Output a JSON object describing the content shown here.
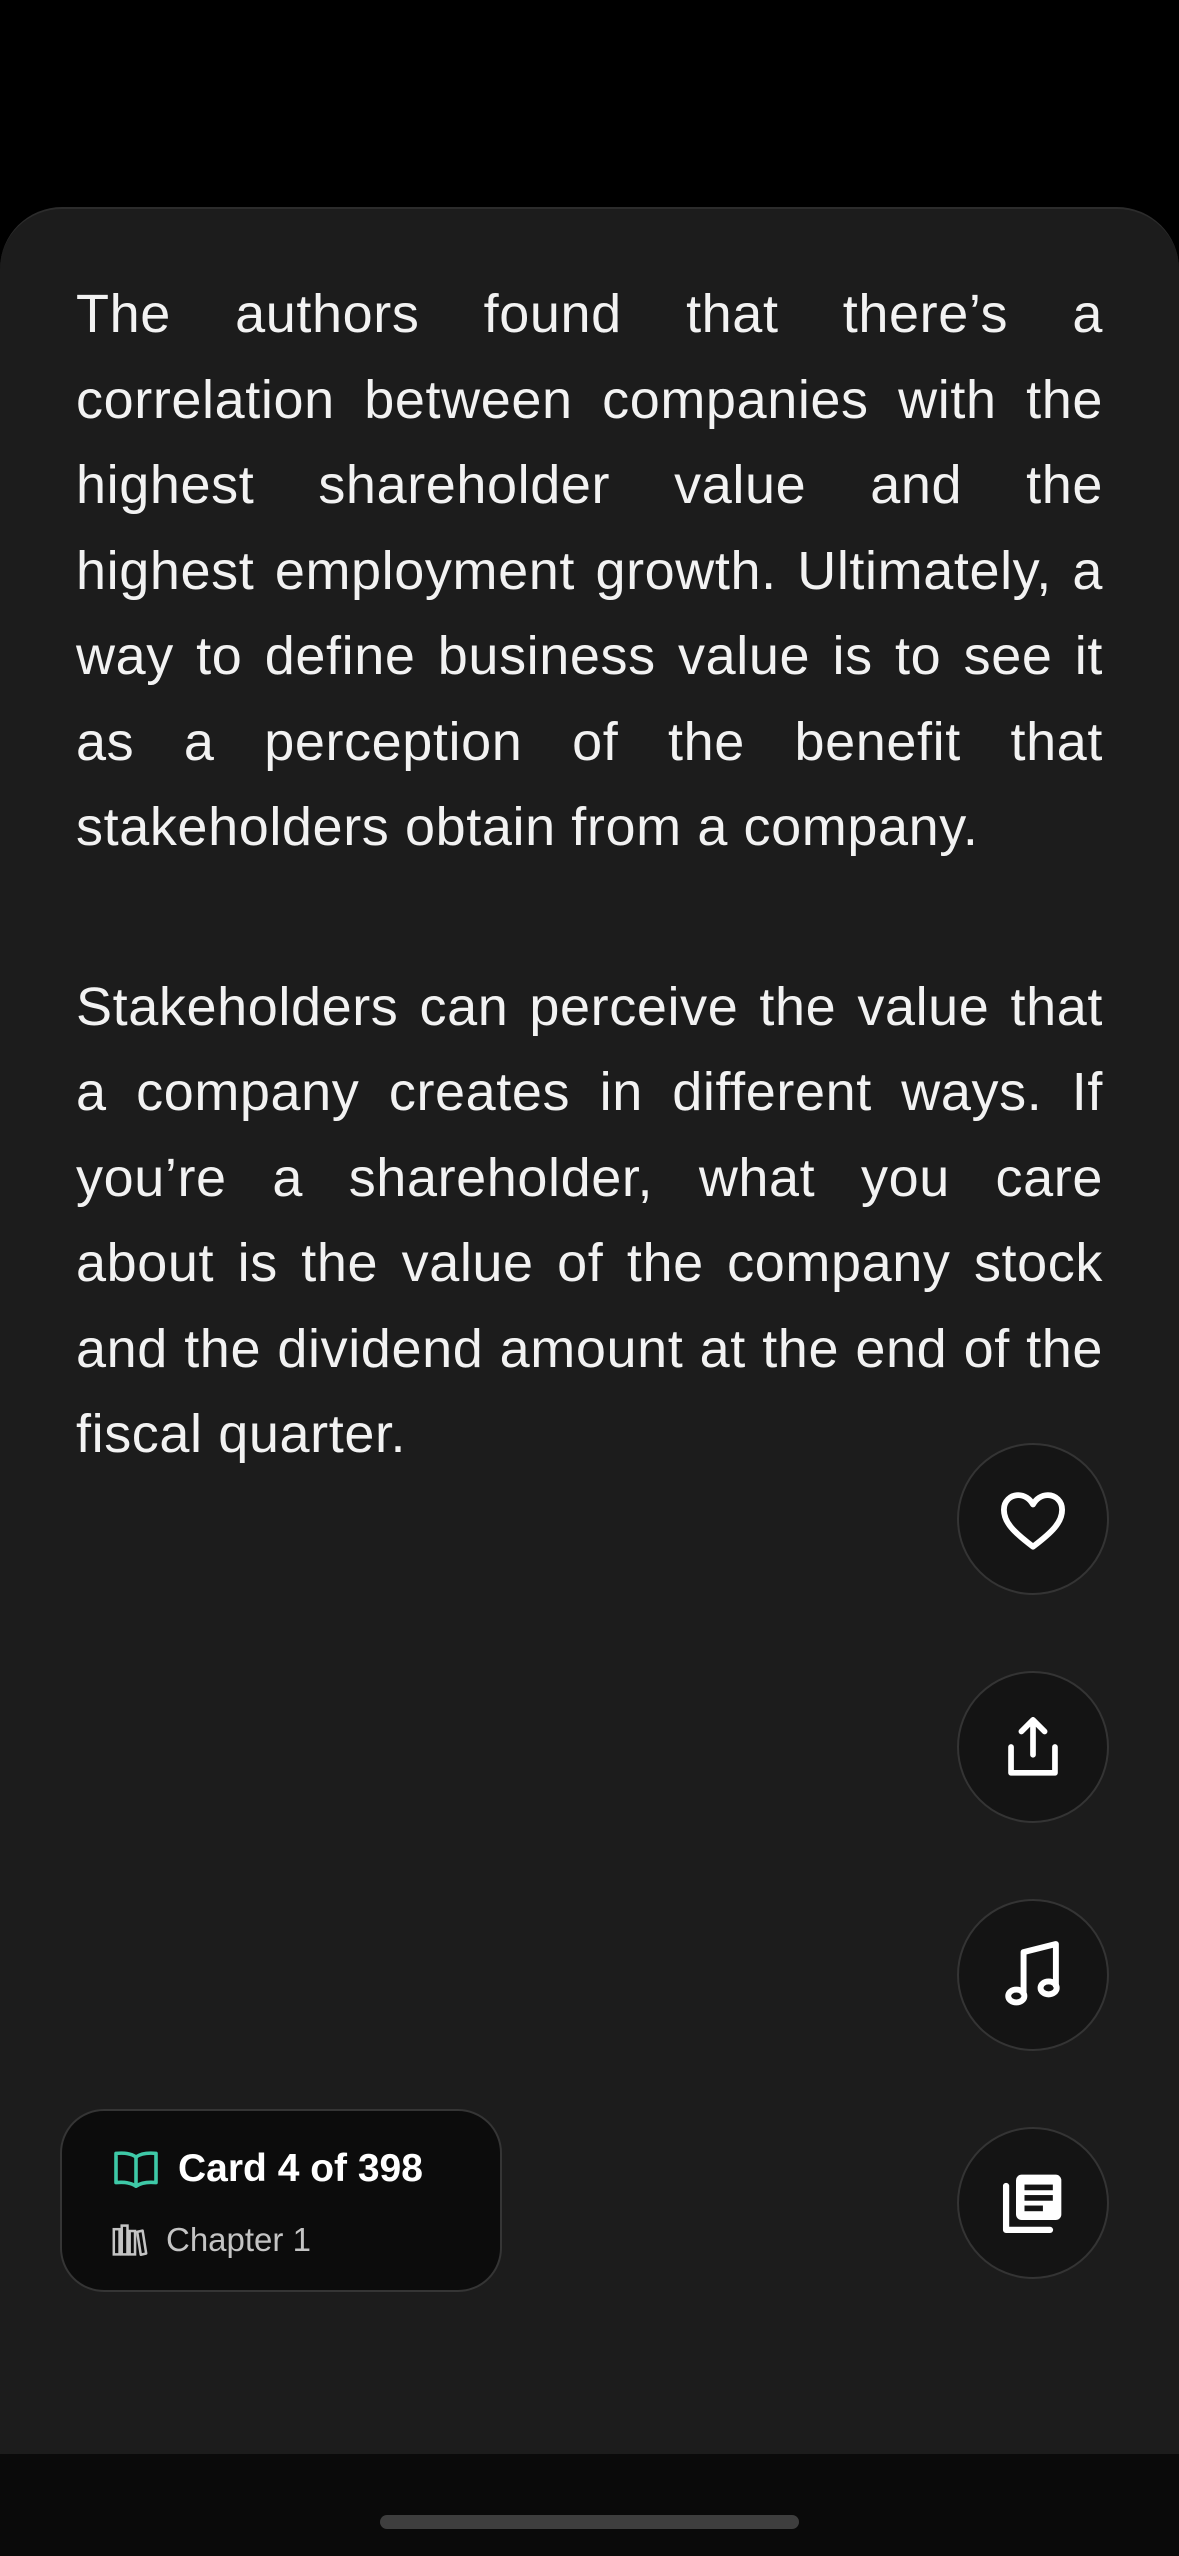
{
  "card": {
    "paragraphs": [
      "The authors found that there’s a correlation between companies with the highest shareholder value and the highest employment growth. Ultimately, a way to define business value is to see it as a perception of the benefit that stakeholders obtain from a company.",
      "Stakeholders can perceive the value that a company creates in different ways. If you’re a shareholder, what you care about is the value of the company stock and the dividend amount at the end of the fiscal quarter."
    ]
  },
  "actions": {
    "like_icon": "heart-icon",
    "share_icon": "share-icon",
    "audio_icon": "music-note-icon",
    "toc_icon": "library-icon"
  },
  "progress": {
    "label": "Card 4 of 398",
    "chapter": "Chapter 1",
    "book_icon": "open-book-icon",
    "chapter_icon": "books-icon"
  },
  "colors": {
    "accent": "#3ec9a7",
    "background": "#1c1c1c",
    "text": "#f2f2f2"
  }
}
